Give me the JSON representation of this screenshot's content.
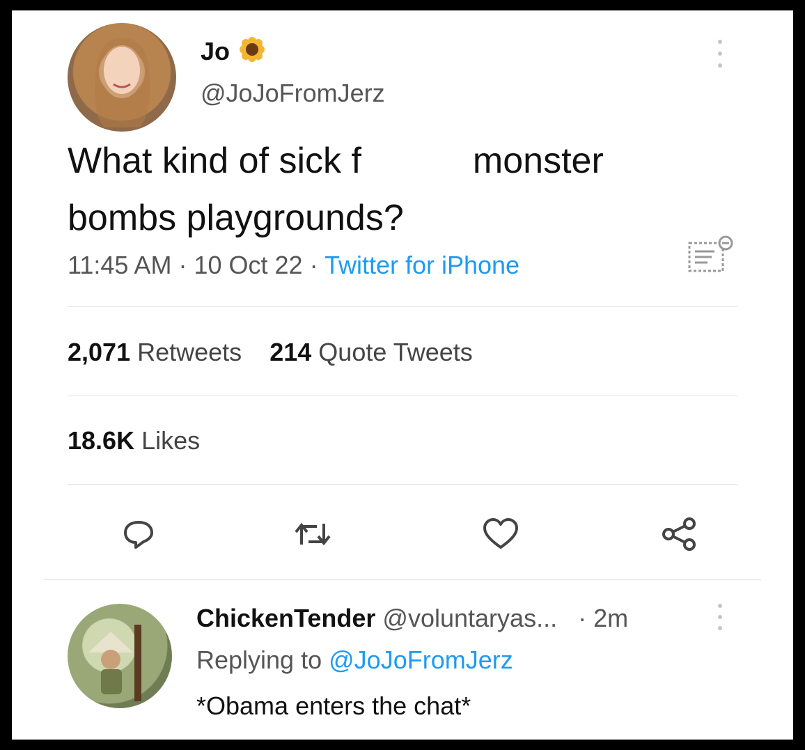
{
  "tweet": {
    "name": "Jo",
    "handle": "@JoJoFromJerz",
    "text_part1": "What kind of sick f",
    "text_part2": "monster",
    "text_line2": "bombs playgrounds?",
    "time": "11:45 AM",
    "separator": "·",
    "date": "10 Oct 22",
    "source": "Twitter for iPhone",
    "retweets_count": "2,071",
    "retweets_label": "Retweets",
    "quotes_count": "214",
    "quotes_label": "Quote Tweets",
    "likes_count": "18.6K",
    "likes_label": "Likes"
  },
  "reply": {
    "name": "ChickenTender",
    "handle": "@voluntaryas...",
    "time": "· 2m",
    "replying_label": "Replying to",
    "replying_to": "@JoJoFromJerz",
    "text": "*Obama enters the chat*"
  },
  "colors": {
    "accent": "#1d9bf0",
    "secondary_text": "#555555",
    "icon": "#444444"
  },
  "icons": [
    "sunflower-icon",
    "more-icon",
    "analytics-icon",
    "reply-icon",
    "retweet-icon",
    "like-icon",
    "share-icon"
  ]
}
